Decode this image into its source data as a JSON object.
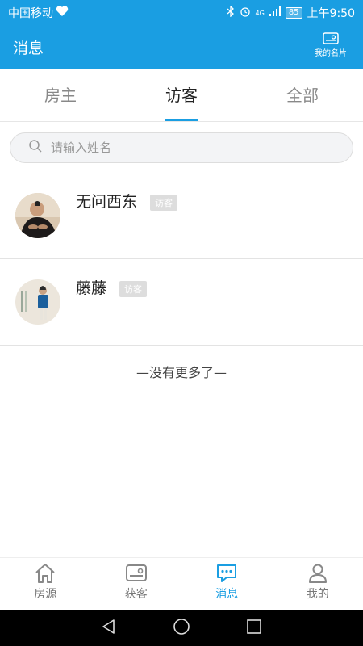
{
  "status_bar": {
    "carrier": "中国移动",
    "network": "4G",
    "battery": "85",
    "time": "上午9:50"
  },
  "header": {
    "title": "消息",
    "card_label": "我的名片"
  },
  "tabs": [
    {
      "label": "房主",
      "active": false
    },
    {
      "label": "访客",
      "active": true
    },
    {
      "label": "全部",
      "active": false
    }
  ],
  "search": {
    "placeholder": "请输入姓名",
    "value": ""
  },
  "contacts": [
    {
      "name": "无问西东",
      "tag": "访客"
    },
    {
      "name": "藤藤",
      "tag": "访客"
    }
  ],
  "list_footer": "—没有更多了—",
  "bottom_nav": [
    {
      "label": "房源",
      "icon": "home-icon",
      "active": false
    },
    {
      "label": "获客",
      "icon": "card-icon",
      "active": false
    },
    {
      "label": "消息",
      "icon": "chat-icon",
      "active": true
    },
    {
      "label": "我的",
      "icon": "person-icon",
      "active": false
    }
  ],
  "colors": {
    "accent": "#1a9ee2",
    "badge_bg": "#dddddd"
  }
}
